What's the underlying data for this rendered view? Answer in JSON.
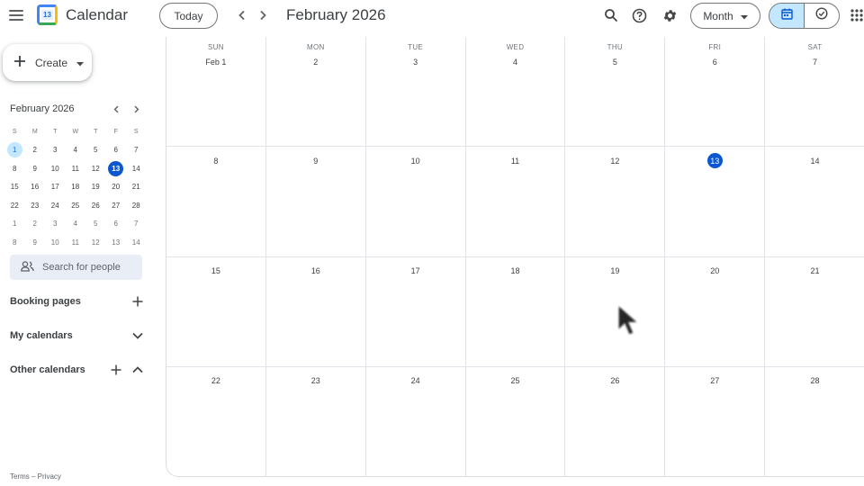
{
  "header": {
    "app_title": "Calendar",
    "logo_day": "13",
    "today_label": "Today",
    "month_title": "February 2026",
    "view_label": "Month"
  },
  "sidebar": {
    "create_label": "Create",
    "mini_title": "February 2026",
    "dow": [
      "S",
      "M",
      "T",
      "W",
      "T",
      "F",
      "S"
    ],
    "weeks": [
      [
        "1",
        "2",
        "3",
        "4",
        "5",
        "6",
        "7"
      ],
      [
        "8",
        "9",
        "10",
        "11",
        "12",
        "13",
        "14"
      ],
      [
        "15",
        "16",
        "17",
        "18",
        "19",
        "20",
        "21"
      ],
      [
        "22",
        "23",
        "24",
        "25",
        "26",
        "27",
        "28"
      ],
      [
        "1",
        "2",
        "3",
        "4",
        "5",
        "6",
        "7"
      ],
      [
        "8",
        "9",
        "10",
        "11",
        "12",
        "13",
        "14"
      ]
    ],
    "search_placeholder": "Search for people",
    "booking_pages": "Booking pages",
    "my_calendars": "My calendars",
    "other_calendars": "Other calendars",
    "footer": "Terms – Privacy"
  },
  "grid": {
    "dow": [
      "SUN",
      "MON",
      "TUE",
      "WED",
      "THU",
      "FRI",
      "SAT"
    ],
    "weeks": [
      [
        "Feb 1",
        "2",
        "3",
        "4",
        "5",
        "6",
        "7"
      ],
      [
        "8",
        "9",
        "10",
        "11",
        "12",
        "13",
        "14"
      ],
      [
        "15",
        "16",
        "17",
        "18",
        "19",
        "20",
        "21"
      ],
      [
        "22",
        "23",
        "24",
        "25",
        "26",
        "27",
        "28"
      ]
    ],
    "today": "13"
  },
  "colors": {
    "accent": "#0b57d0",
    "selected_bg": "#c2e7ff",
    "search_bg": "#e9eef6"
  },
  "icons": {
    "menu": "menu-icon",
    "prev": "chevron-left-icon",
    "next": "chevron-right-icon",
    "search": "search-icon",
    "help": "help-icon",
    "settings": "gear-icon",
    "calendar_view": "calendar-icon",
    "tasks_view": "task-check-icon",
    "apps": "apps-grid-icon"
  }
}
